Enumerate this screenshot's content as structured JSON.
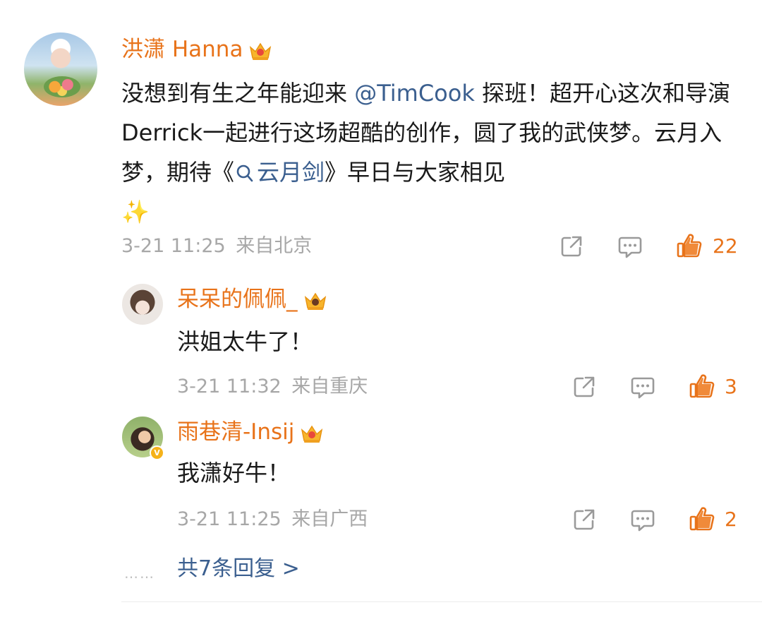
{
  "post": {
    "author": "洪潇 Hanna",
    "text_parts": {
      "part1": "没想到有生之年能迎来 ",
      "mention": "@TimCook",
      "part2": " 探班！超开心这次和导演Derrick一起进行这场超酷的创作，圆了我的武侠梦。云月入梦，期待《",
      "topic": "云月剑",
      "part3": "》早日与大家相见",
      "emoji": "✨"
    },
    "time": "3-21 11:25",
    "location": "来自北京",
    "likes": "22"
  },
  "comments": [
    {
      "author": "呆呆的佩佩_",
      "text": "洪姐太牛了！",
      "time": "3-21 11:32",
      "location": "来自重庆",
      "likes": "3"
    },
    {
      "author": "雨巷清-Insij",
      "text": "我潇好牛！",
      "time": "3-21 11:25",
      "location": "来自广西",
      "likes": "2"
    }
  ],
  "replies": {
    "dots": "……",
    "label": "共7条回复 >"
  },
  "icons": {
    "share": "share-icon",
    "comment": "comment-icon",
    "like": "thumbs-up-icon",
    "vip": "crown-icon",
    "search": "search-icon",
    "verified": "verified-badge-icon"
  },
  "colors": {
    "name": "#e8731a",
    "link": "#3b5f8f",
    "meta": "#a7a7a7",
    "like": "#e8731a"
  }
}
